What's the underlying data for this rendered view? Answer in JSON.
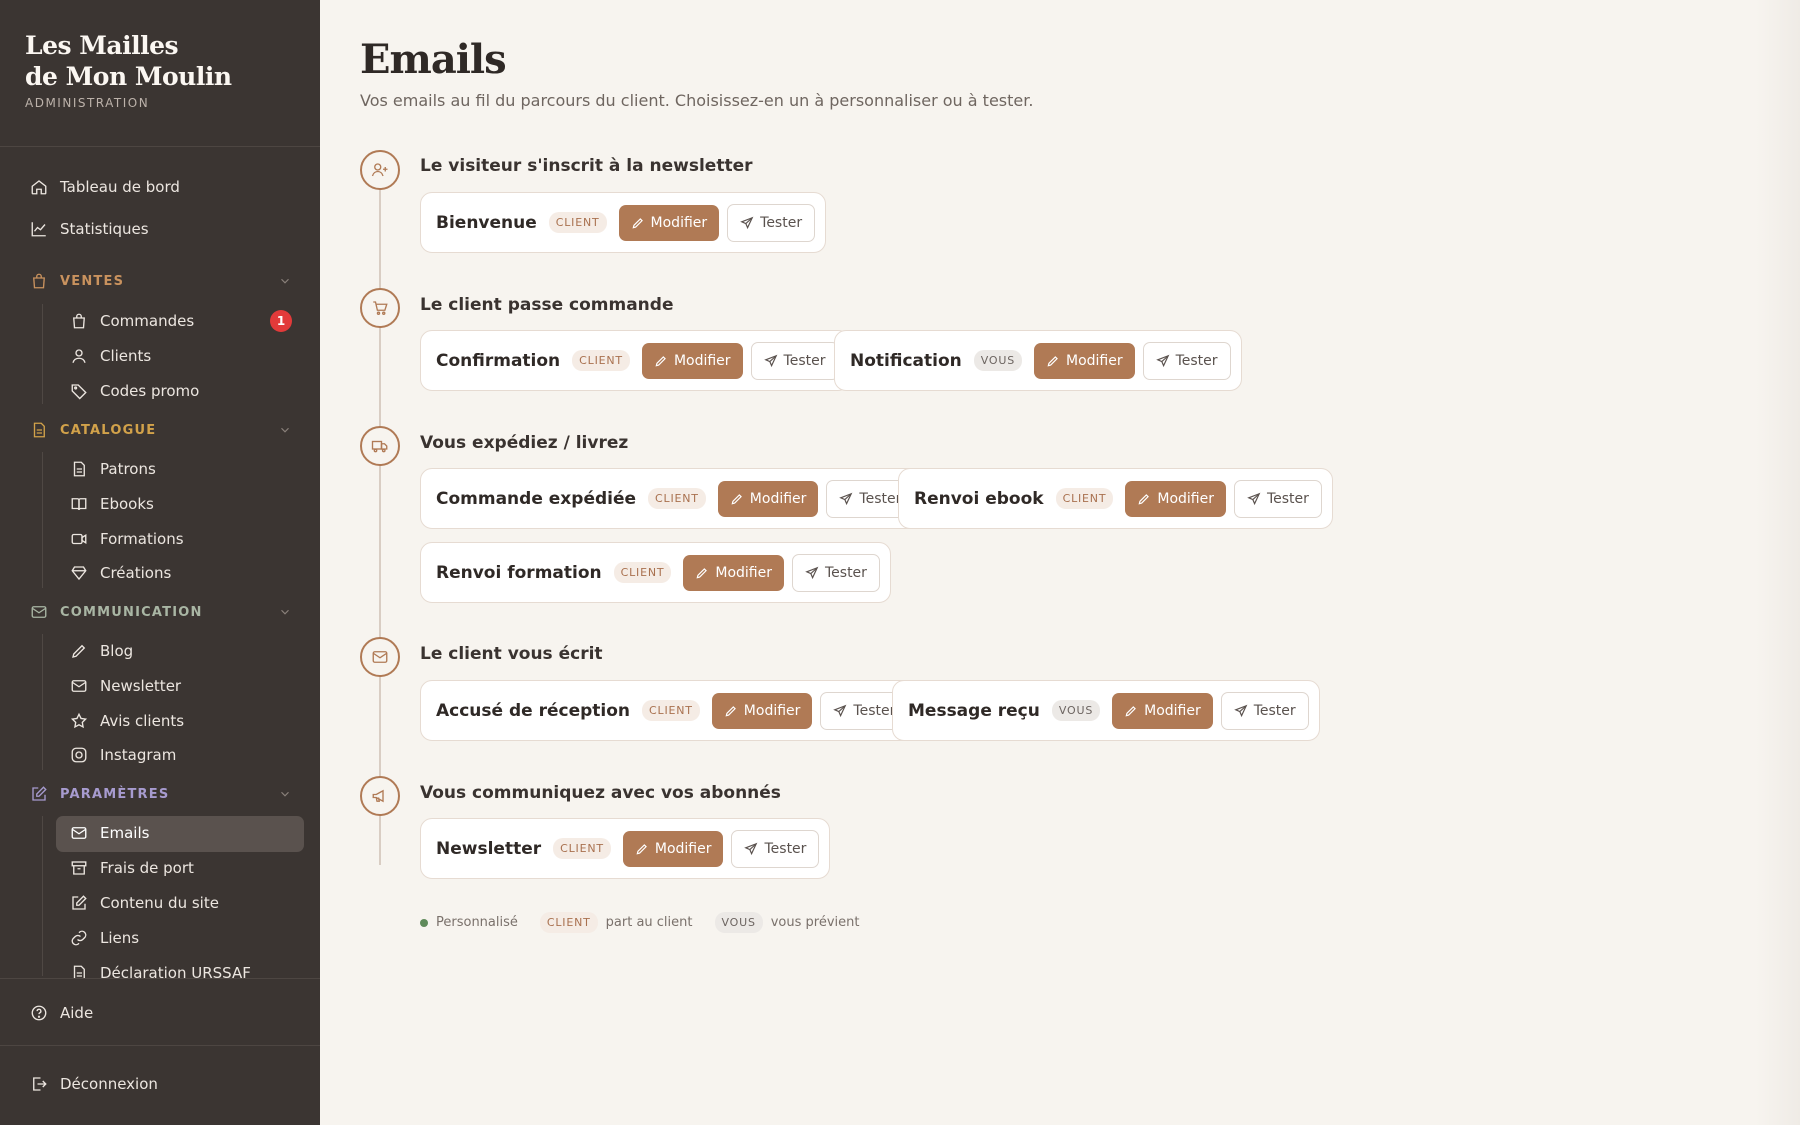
{
  "brand": {
    "line1": "Les Mailles",
    "line2": "de Mon Moulin",
    "subtitle": "ADMINISTRATION"
  },
  "sidebar": {
    "top": [
      {
        "label": "Tableau de bord",
        "icon": "home-icon"
      },
      {
        "label": "Statistiques",
        "icon": "chart-line-icon"
      }
    ],
    "sections": {
      "ventes": {
        "label": "VENTES",
        "color": "#c9925e",
        "items": [
          {
            "label": "Commandes",
            "icon": "bag-icon",
            "badge": "1"
          },
          {
            "label": "Clients",
            "icon": "users-icon"
          },
          {
            "label": "Codes promo",
            "icon": "tag-icon"
          }
        ]
      },
      "catalogue": {
        "label": "CATALOGUE",
        "color": "#d2a24a",
        "items": [
          {
            "label": "Patrons",
            "icon": "document-icon"
          },
          {
            "label": "Ebooks",
            "icon": "book-icon"
          },
          {
            "label": "Formations",
            "icon": "video-icon"
          },
          {
            "label": "Créations",
            "icon": "gem-icon"
          }
        ]
      },
      "communication": {
        "label": "COMMUNICATION",
        "color": "#a9b6a4",
        "items": [
          {
            "label": "Blog",
            "icon": "pen-icon"
          },
          {
            "label": "Newsletter",
            "icon": "mail-icon"
          },
          {
            "label": "Avis clients",
            "icon": "star-icon"
          },
          {
            "label": "Instagram",
            "icon": "instagram-icon"
          }
        ]
      },
      "parametres": {
        "label": "PARAMÈTRES",
        "color": "#a79bcf",
        "items": [
          {
            "label": "Emails",
            "icon": "mail-icon",
            "active": true
          },
          {
            "label": "Frais de port",
            "icon": "box-icon"
          },
          {
            "label": "Contenu du site",
            "icon": "edit-icon"
          },
          {
            "label": "Liens",
            "icon": "link-icon"
          },
          {
            "label": "Déclaration URSSAF",
            "icon": "document-icon"
          }
        ]
      }
    },
    "footer": {
      "help": "Aide",
      "logout": "Déconnexion"
    }
  },
  "page": {
    "title": "Emails",
    "subtitle": "Vos emails au fil du parcours du client. Choisissez-en un à personnaliser ou à tester."
  },
  "labels": {
    "modify": "Modifier",
    "test": "Tester",
    "client_tag": "CLIENT",
    "vous_tag": "VOUS"
  },
  "steps": [
    {
      "title": "Le visiteur s'inscrit à la newsletter",
      "icon": "user-plus-icon",
      "emails": [
        {
          "name": "Bienvenue",
          "tag": "CLIENT"
        }
      ]
    },
    {
      "title": "Le client passe commande",
      "icon": "cart-icon",
      "emails": [
        {
          "name": "Confirmation",
          "tag": "CLIENT"
        },
        {
          "name": "Notification",
          "tag": "VOUS"
        }
      ]
    },
    {
      "title": "Vous expédiez / livrez",
      "icon": "truck-icon",
      "emails": [
        {
          "name": "Commande expédiée",
          "tag": "CLIENT"
        },
        {
          "name": "Renvoi ebook",
          "tag": "CLIENT"
        },
        {
          "name": "Renvoi formation",
          "tag": "CLIENT"
        }
      ]
    },
    {
      "title": "Le client vous écrit",
      "icon": "mail-icon",
      "emails": [
        {
          "name": "Accusé de réception",
          "tag": "CLIENT"
        },
        {
          "name": "Message reçu",
          "tag": "VOUS"
        }
      ]
    },
    {
      "title": "Vous communiquez avec vos abonnés",
      "icon": "megaphone-icon",
      "emails": [
        {
          "name": "Newsletter",
          "tag": "CLIENT"
        }
      ]
    }
  ],
  "legend": {
    "customized": "Personnalisé",
    "client_tag": "CLIENT",
    "client_text": "part au client",
    "vous_tag": "VOUS",
    "vous_text": "vous prévient",
    "customized_color": "#5f8a5a"
  },
  "colors": {
    "accent": "#b07a55",
    "sidebar_bg": "#3b3532",
    "page_bg": "#f7f4ef",
    "badge": "#e23a3a"
  }
}
